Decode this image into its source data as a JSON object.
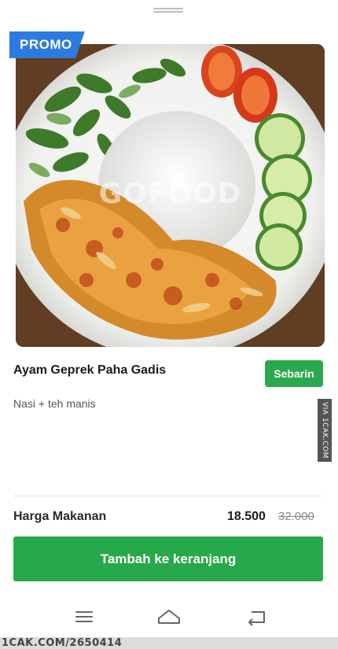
{
  "badge": {
    "label": "PROMO"
  },
  "image": {
    "watermark": "GOFOOD"
  },
  "item": {
    "name": "Ayam Geprek Paha Gadis",
    "share_label": "Sebarin",
    "description": "Nasi + teh manis"
  },
  "pricing": {
    "label": "Harga Makanan",
    "price": "18.500",
    "original_price": "32.000"
  },
  "cta": {
    "label": "Tambah ke keranjang"
  },
  "overlay": {
    "vertical_watermark": "VIA 1CAK.COM"
  },
  "footer": {
    "text": "1CAK.COM/2650414"
  },
  "colors": {
    "accent": "#27a84a",
    "promo": "#2d7be0"
  },
  "icons": {
    "nav_menu": "menu-icon",
    "nav_home": "home-icon",
    "nav_back": "back-icon"
  }
}
